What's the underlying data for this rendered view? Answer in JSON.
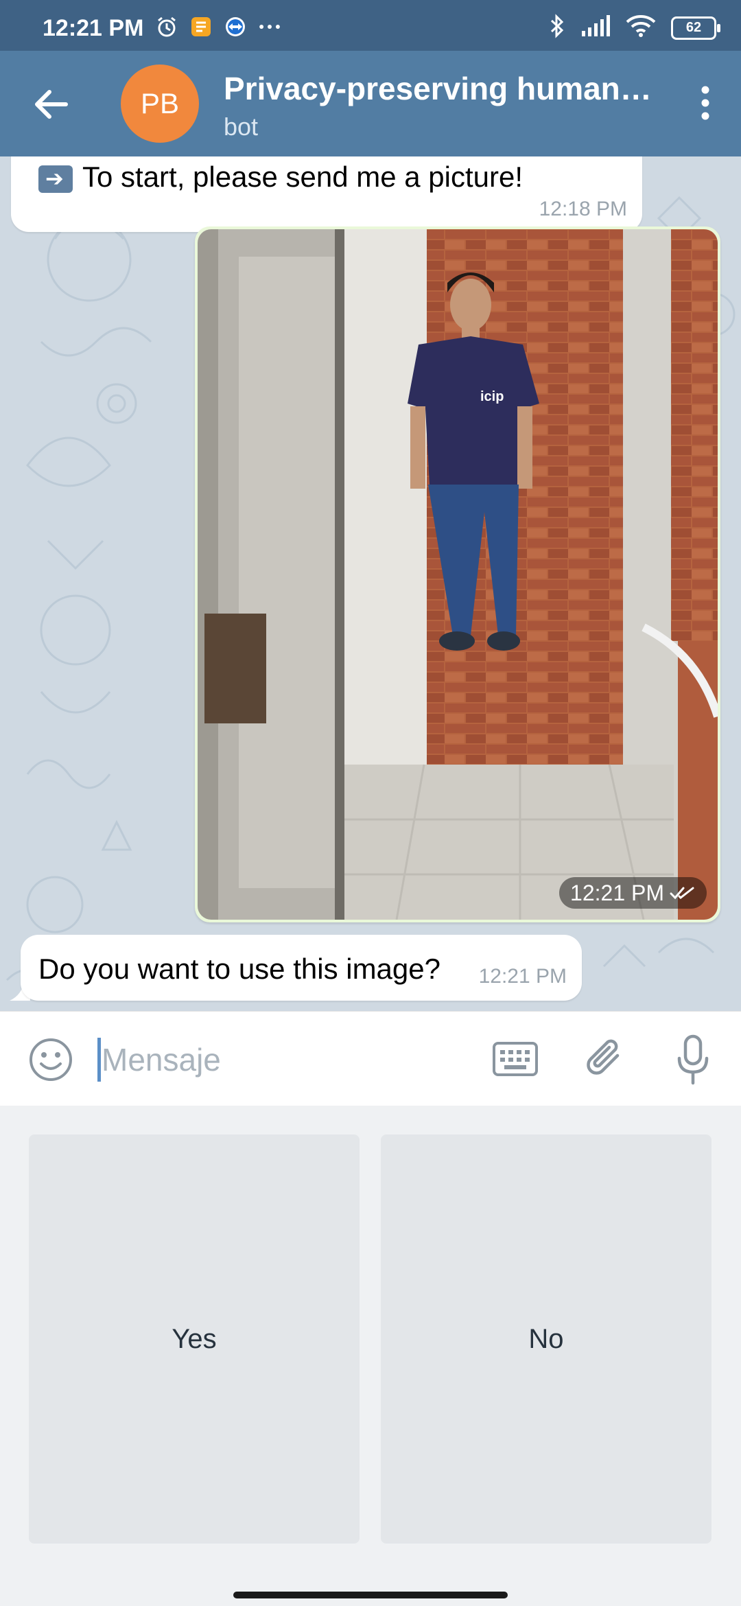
{
  "status_bar": {
    "time": "12:21 PM",
    "left_icons": [
      "alarm-icon",
      "notes-icon",
      "teamviewer-icon",
      "more-dots-icon"
    ],
    "right_icons": [
      "bluetooth-icon",
      "signal-icon",
      "wifi-icon"
    ],
    "battery": "62"
  },
  "app_bar": {
    "avatar_initials": "PB",
    "title": "Privacy-preserving human…",
    "subtitle": "bot"
  },
  "messages": {
    "top": {
      "text": "To start, please send me a picture!",
      "time": "12:18 PM"
    },
    "photo": {
      "time": "12:21 PM",
      "status_icon": "double-check-icon",
      "shirt_logo": "icip"
    },
    "question": {
      "text": "Do you want to use this image?",
      "time": "12:21 PM"
    }
  },
  "input": {
    "placeholder": "Mensaje"
  },
  "bot_keyboard": {
    "yes_label": "Yes",
    "no_label": "No"
  },
  "colors": {
    "app_bar": "#527da3",
    "status_bar": "#3f6285",
    "avatar": "#f1883d",
    "outgoing_bubble": "#eaf8d9"
  }
}
